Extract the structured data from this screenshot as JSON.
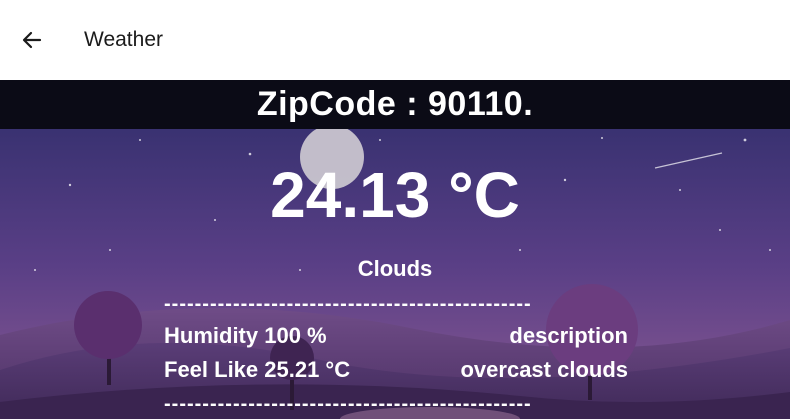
{
  "appbar": {
    "back_icon": "arrow-left-icon",
    "title": "Weather"
  },
  "weather": {
    "zip_label": "ZipCode : 90110.",
    "temperature": "24.13 °C",
    "main": "Clouds",
    "divider": "------------------------------------------------",
    "humidity": "Humidity 100 %",
    "description_label": "description",
    "feels_like": "Feel Like 25.21 °C",
    "description_value": "overcast clouds"
  },
  "colors": {
    "sky_top": "#2e2d6a",
    "sky_bottom": "#8a5a93",
    "band": "#0b0b16",
    "text": "#ffffff"
  }
}
